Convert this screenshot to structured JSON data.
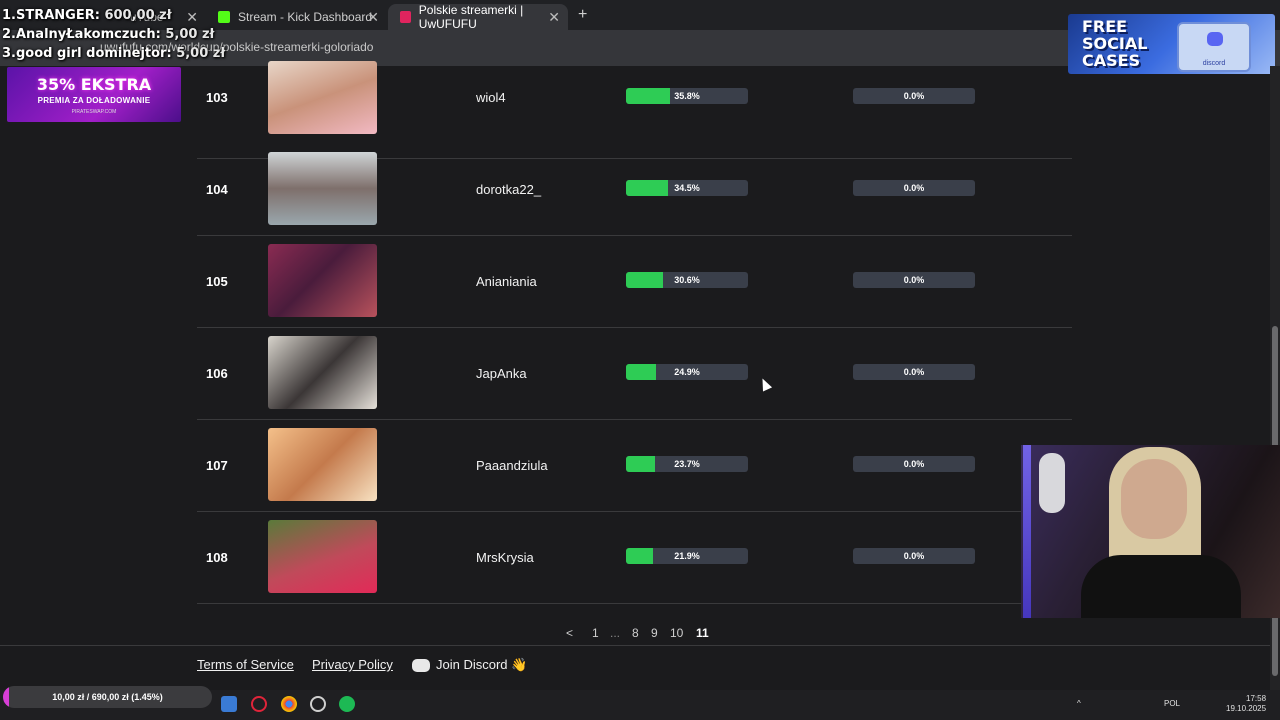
{
  "browser": {
    "tabs": [
      {
        "label": "uTube",
        "active": false
      },
      {
        "label": "Stream - Kick Dashboard",
        "active": false
      },
      {
        "label": "Polskie streamerki | UwUFUFU",
        "active": true
      }
    ],
    "new_tab": "+",
    "close": "✕",
    "url": "uwufufu.com/worldcup/polskie-streamerki-goloriado"
  },
  "donations": [
    {
      "rank": "1.",
      "name": "STRANGER:",
      "amount": "600,00 zł"
    },
    {
      "rank": "2.",
      "name": "AnalnyŁakomczuch:",
      "amount": "5,00 zł"
    },
    {
      "rank": "3.",
      "name": "good girl dominejtor:",
      "amount": "5,00 zł"
    }
  ],
  "ads": {
    "left": {
      "headline": "35% EKSTRA",
      "sub": "PREMIA ZA DOŁADOWANIE",
      "site": "PIRATESWAP.COM"
    },
    "right": {
      "line1": "FREE",
      "line2": "SOCIAL",
      "line3": "CASES",
      "tag": "discord"
    }
  },
  "rows": [
    {
      "rank": "103",
      "name": "wiol4",
      "win_pct": "35.8%",
      "win_val": 35.8,
      "final_pct": "0.0%",
      "final_val": 0.0
    },
    {
      "rank": "104",
      "name": "dorotka22_",
      "win_pct": "34.5%",
      "win_val": 34.5,
      "final_pct": "0.0%",
      "final_val": 0.0
    },
    {
      "rank": "105",
      "name": "Anianiania",
      "win_pct": "30.6%",
      "win_val": 30.6,
      "final_pct": "0.0%",
      "final_val": 0.0
    },
    {
      "rank": "106",
      "name": "JapAnka",
      "win_pct": "24.9%",
      "win_val": 24.9,
      "final_pct": "0.0%",
      "final_val": 0.0
    },
    {
      "rank": "107",
      "name": "Paaandziula",
      "win_pct": "23.7%",
      "win_val": 23.7,
      "final_pct": "0.0%",
      "final_val": 0.0
    },
    {
      "rank": "108",
      "name": "MrsKrysia",
      "win_pct": "21.9%",
      "win_val": 21.9,
      "final_pct": "0.0%",
      "final_val": 0.0
    }
  ],
  "pagination": {
    "prev": "<",
    "p1": "1",
    "ellipsis": "...",
    "p8": "8",
    "p9": "9",
    "p10": "10",
    "p11": "11",
    "current": "11"
  },
  "footer": {
    "terms": "Terms of Service",
    "privacy": "Privacy Policy",
    "discord": "Join Discord 👋"
  },
  "goal": {
    "label": "10,00 zł / 690,00 zł (1.45%)",
    "fraction": 0.0145
  },
  "taskbar": {
    "lang": "POL",
    "time": "17:58",
    "date": "19.10.2025"
  },
  "colors": {
    "progress": "#2ecc55",
    "kick": "#53fc18",
    "uwufufu": "#e0245e",
    "goal": "#d73ed6"
  }
}
